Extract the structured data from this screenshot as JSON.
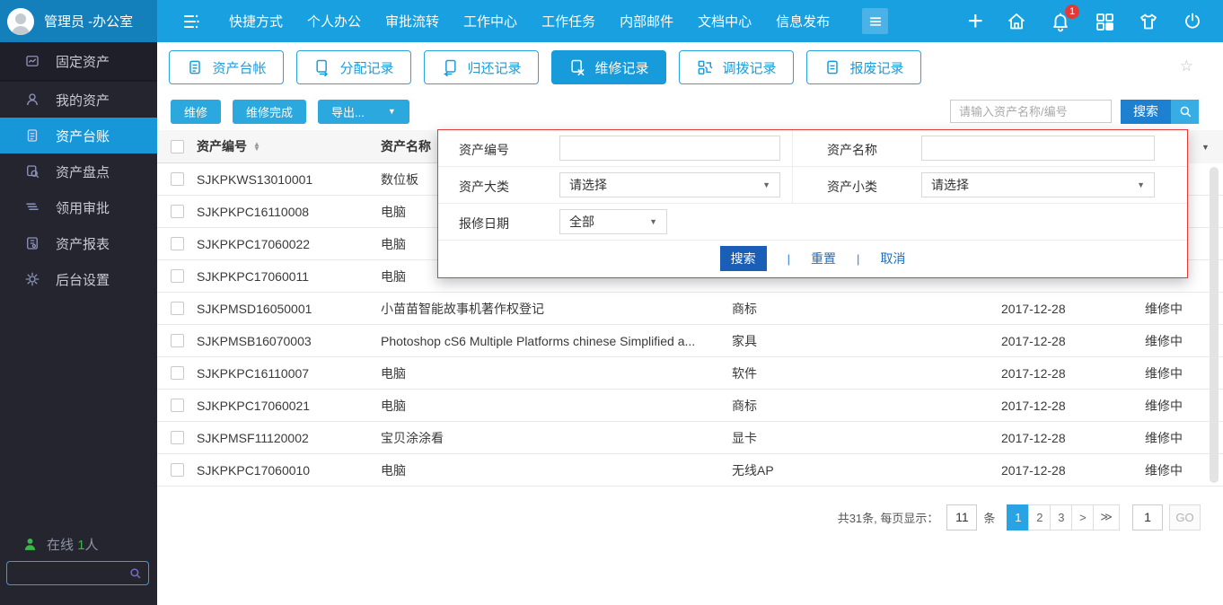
{
  "topbar": {
    "user_name": "管理员 -办公室",
    "nav_items": [
      "快捷方式",
      "个人办公",
      "审批流转",
      "工作中心",
      "工作任务",
      "内部邮件",
      "文档中心",
      "信息发布"
    ],
    "notification_count": "1"
  },
  "sidebar": {
    "items": [
      {
        "label": "固定资产",
        "icon": "chart-icon",
        "active": false
      },
      {
        "label": "我的资产",
        "icon": "person-icon",
        "active": false
      },
      {
        "label": "资产台账",
        "icon": "ledger-icon",
        "active": true
      },
      {
        "label": "资产盘点",
        "icon": "doc-search-icon",
        "active": false
      },
      {
        "label": "领用审批",
        "icon": "layers-icon",
        "active": false
      },
      {
        "label": "资产报表",
        "icon": "report-icon",
        "active": false
      },
      {
        "label": "后台设置",
        "icon": "gear-icon",
        "active": false
      }
    ],
    "online_label": "在线",
    "online_count": "1",
    "online_unit": "人"
  },
  "tabs": [
    {
      "label": "资产台帐",
      "icon": "clipboard-icon",
      "active": false
    },
    {
      "label": "分配记录",
      "icon": "doc-swap-icon",
      "active": false
    },
    {
      "label": "归还记录",
      "icon": "doc-return-icon",
      "active": false
    },
    {
      "label": "维修记录",
      "icon": "doc-tool-icon",
      "active": true
    },
    {
      "label": "调拨记录",
      "icon": "squares-swap-icon",
      "active": false
    },
    {
      "label": "报废记录",
      "icon": "clipboard-lines-icon",
      "active": false
    }
  ],
  "toolbar": {
    "repair_button": "维修",
    "repair_done_button": "维修完成",
    "export_button": "导出...",
    "search_placeholder": "请输入资产名称/编号",
    "search_button": "搜索"
  },
  "filter_popup": {
    "asset_code_label": "资产编号",
    "asset_name_label": "资产名称",
    "major_class_label": "资产大类",
    "major_class_value": "请选择",
    "minor_class_label": "资产小类",
    "minor_class_value": "请选择",
    "repair_date_label": "报修日期",
    "repair_date_value": "全部",
    "search_button": "搜索",
    "reset_button": "重置",
    "cancel_button": "取消"
  },
  "table": {
    "headers": {
      "code": "资产编号",
      "name": "资产名称"
    },
    "rows": [
      {
        "code": "SJKPKWS13010001",
        "name": "数位板",
        "category": "",
        "date": "",
        "status": ""
      },
      {
        "code": "SJKPKPC16110008",
        "name": "电脑",
        "category": "",
        "date": "",
        "status": ""
      },
      {
        "code": "SJKPKPC17060022",
        "name": "电脑",
        "category": "",
        "date": "",
        "status": ""
      },
      {
        "code": "SJKPKPC17060011",
        "name": "电脑",
        "category": "",
        "date": "",
        "status": ""
      },
      {
        "code": "SJKPMSD16050001",
        "name": "小苗苗智能故事机著作权登记",
        "category": "商标",
        "date": "2017-12-28",
        "status": "维修中"
      },
      {
        "code": "SJKPMSB16070003",
        "name": "Photoshop cS6 Multiple Platforms chinese Simplified a...",
        "category": "家具",
        "date": "2017-12-28",
        "status": "维修中"
      },
      {
        "code": "SJKPKPC16110007",
        "name": "电脑",
        "category": "软件",
        "date": "2017-12-28",
        "status": "维修中"
      },
      {
        "code": "SJKPKPC17060021",
        "name": "电脑",
        "category": "商标",
        "date": "2017-12-28",
        "status": "维修中"
      },
      {
        "code": "SJKPMSF11120002",
        "name": "宝贝涂涂看",
        "category": "显卡",
        "date": "2017-12-28",
        "status": "维修中"
      },
      {
        "code": "SJKPKPC17060010",
        "name": "电脑",
        "category": "无线AP",
        "date": "2017-12-28",
        "status": "维修中"
      }
    ]
  },
  "pagination": {
    "summary": "共31条, 每页显示：",
    "page_size": "11",
    "unit": "条",
    "pages": [
      "1",
      "2",
      "3"
    ],
    "active_page": "1",
    "next": ">",
    "last": "≫",
    "jump_value": "1",
    "go_label": "GO"
  },
  "colors": {
    "topbar": "#18a0e0",
    "topbar_left": "#1480bb",
    "accent": "#1d9cdc",
    "active_tab": "#189bdb",
    "toolbar_button": "#2ba8de",
    "search_button": "#1d80d0",
    "popup_border": "#e23b3b",
    "popup_primary_button": "#1a5eb8",
    "sidebar_bg": "#252530",
    "sidebar_active": "#1897d8",
    "online_green": "#3cb549",
    "badge_red": "#e53935",
    "pagination_active": "#29a3e3"
  }
}
